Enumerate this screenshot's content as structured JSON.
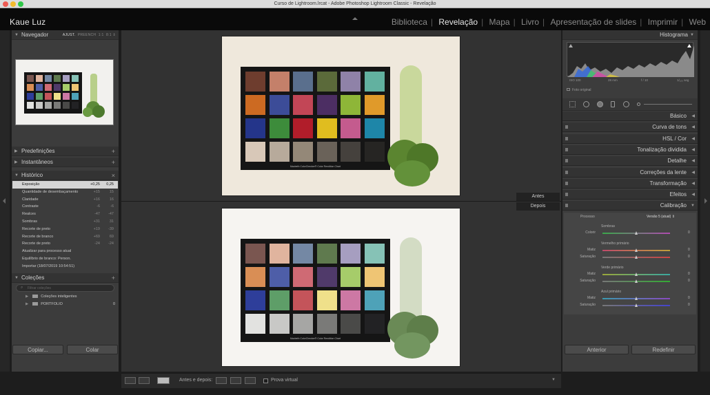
{
  "window": {
    "title": "Curso de Lightroom.lrcat - Adobe Photoshop Lightroom Classic - Revelação"
  },
  "identity_plate": "Kaue Luz",
  "modules": [
    "Biblioteca",
    "Revelação",
    "Mapa",
    "Livro",
    "Apresentação de slides",
    "Imprimir",
    "Web"
  ],
  "active_module": "Revelação",
  "left": {
    "navigator": {
      "title": "Navegador",
      "zoom_options": [
        "AJUST.",
        "PREENCH",
        "1:1",
        "8:1"
      ]
    },
    "presets": "Predefinições",
    "snapshots": "Instantâneos",
    "history": {
      "title": "Histórico",
      "items": [
        {
          "label": "Exposição",
          "v1": "+0,25",
          "v2": "0,25"
        },
        {
          "label": "Quantidade de desembaçamento",
          "v1": "+15",
          "v2": "15"
        },
        {
          "label": "Claridade",
          "v1": "+16",
          "v2": "16"
        },
        {
          "label": "Contraste",
          "v1": "-6",
          "v2": "-6"
        },
        {
          "label": "Realces",
          "v1": "-47",
          "v2": "-47"
        },
        {
          "label": "Sombras",
          "v1": "+31",
          "v2": "31"
        },
        {
          "label": "Recorte de preto",
          "v1": "+19",
          "v2": "-39"
        },
        {
          "label": "Recorte de branco",
          "v1": "+69",
          "v2": "69"
        },
        {
          "label": "Recorte de preto",
          "v1": "-24",
          "v2": "-24"
        },
        {
          "label": "Atualizar para processo atual",
          "v1": "",
          "v2": ""
        },
        {
          "label": "Equilíbrio de branco: Person.",
          "v1": "",
          "v2": ""
        },
        {
          "label": "Importar (18/07/2019 10:54:51)",
          "v1": "",
          "v2": ""
        }
      ]
    },
    "collections": {
      "title": "Coleções",
      "search_placeholder": "Filtrar coleções",
      "items": [
        {
          "label": "Coleções inteligentes",
          "count": ""
        },
        {
          "label": "PORTFOLIO",
          "count": "0"
        }
      ]
    },
    "copy_button": "Copiar...",
    "paste_button": "Colar"
  },
  "center": {
    "before_label": "Antes",
    "after_label": "Depois",
    "chart_caption": "Macbeth ColorChecker® Color Rendition Chart",
    "before_patches": [
      "#6e3d2e",
      "#c4806a",
      "#5a6f8d",
      "#5b6a3a",
      "#8f82a8",
      "#62b1a0",
      "#cc6a22",
      "#3c4c98",
      "#c24656",
      "#4c2e63",
      "#8eb638",
      "#e09a2a",
      "#24358a",
      "#3d8c3b",
      "#b11d2a",
      "#e0bd1f",
      "#c45b8e",
      "#1e86a8",
      "#d8c8b8",
      "#b7aa9b",
      "#948878",
      "#6a6259",
      "#45413d",
      "#262523"
    ],
    "after_patches": [
      "#7a5650",
      "#e0b49e",
      "#7488a4",
      "#5f7a4e",
      "#a69ec0",
      "#86c2b6",
      "#d98e55",
      "#4e5ea8",
      "#cf6a74",
      "#503a6a",
      "#a6cc6a",
      "#efc574",
      "#2e3e9a",
      "#5e9e68",
      "#c4545a",
      "#efe08a",
      "#cd78a4",
      "#4ea2b8",
      "#e2e2e0",
      "#c8c8c6",
      "#a6a6a4",
      "#7a7a78",
      "#4a4a48",
      "#222224"
    ],
    "toolbar": {
      "before_after_label": "Antes e depois:",
      "soft_proof_label": "Prova virtual"
    }
  },
  "right": {
    "histogram": {
      "title": "Histograma",
      "iso": "ISO 100",
      "focal": "28 mm",
      "aperture": "f / 10",
      "shutter": "1/₁₂₅ seg",
      "original": "Foto original"
    },
    "sections": [
      "Básico",
      "Curva de tons",
      "HSL / Cor",
      "Tonalização dividida",
      "Detalhe",
      "Correções da lente",
      "Transformação",
      "Efeitos",
      "Calibração"
    ],
    "calibration": {
      "process_label": "Processo",
      "process_value": "Versão 5 (atual)",
      "groups": [
        {
          "title": "Sombras",
          "rows": [
            {
              "label": "Colorir",
              "value": "0"
            }
          ]
        },
        {
          "title": "Vermelho primário",
          "rows": [
            {
              "label": "Matiz",
              "value": "0"
            },
            {
              "label": "Saturação",
              "value": "0"
            }
          ]
        },
        {
          "title": "Verde primário",
          "rows": [
            {
              "label": "Matiz",
              "value": "0"
            },
            {
              "label": "Saturação",
              "value": "0"
            }
          ]
        },
        {
          "title": "Azul primário",
          "rows": [
            {
              "label": "Matiz",
              "value": "0"
            },
            {
              "label": "Saturação",
              "value": "0"
            }
          ]
        }
      ]
    },
    "previous_button": "Anterior",
    "reset_button": "Redefinir"
  }
}
